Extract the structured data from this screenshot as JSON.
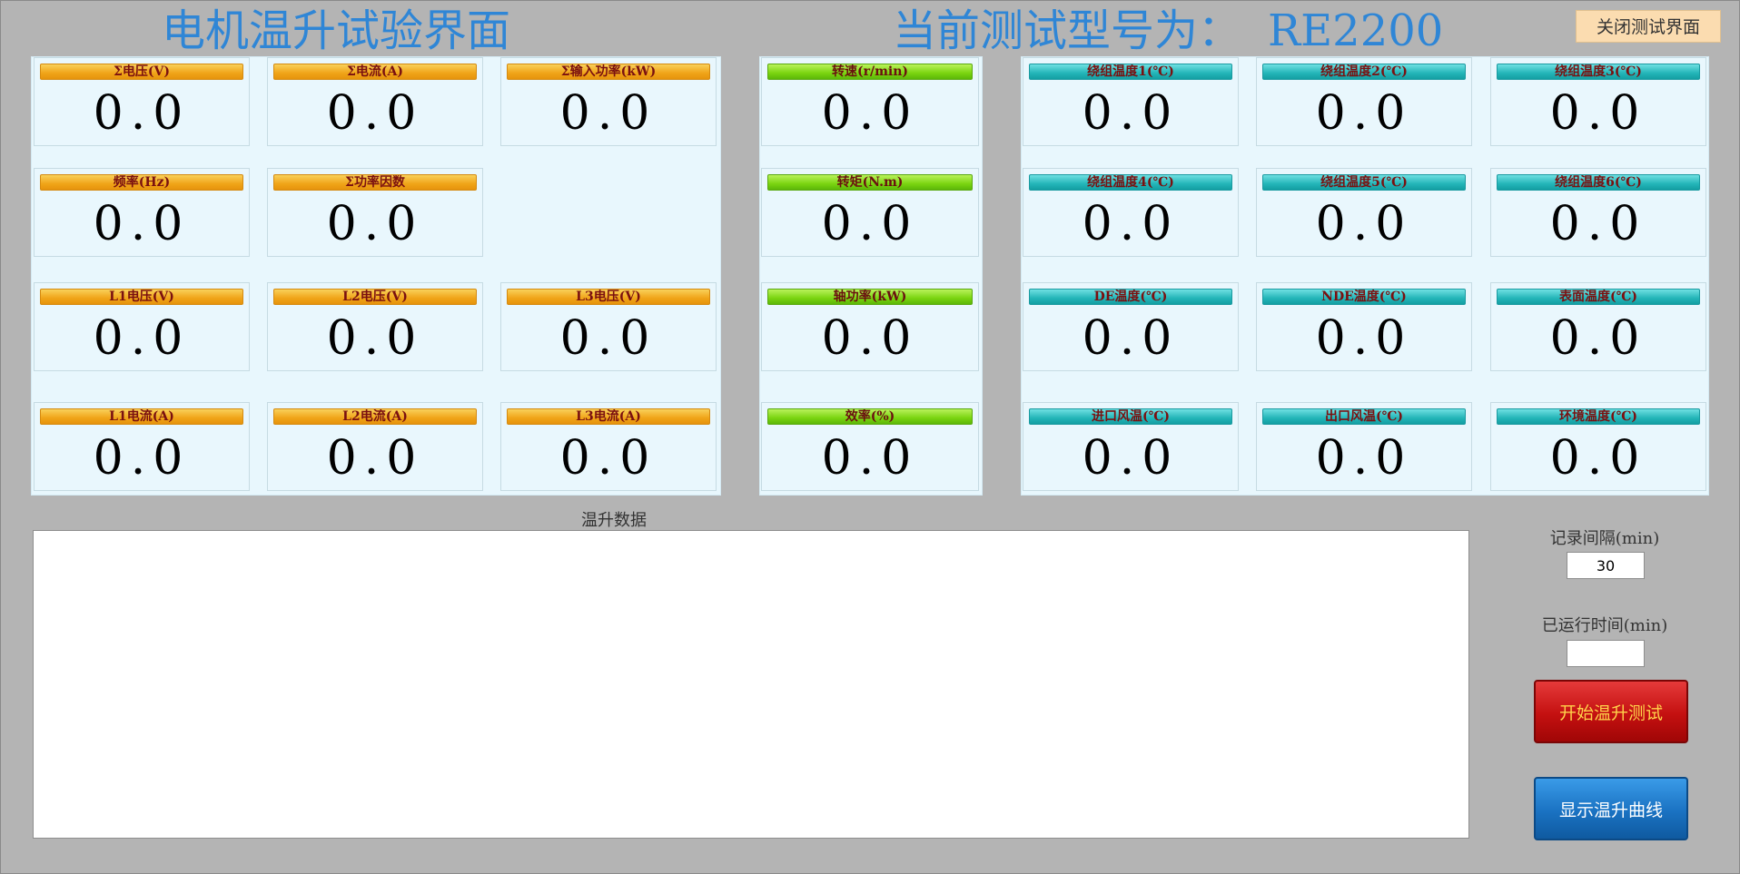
{
  "header": {
    "app_title": "电机温升试验界面",
    "model_title": "当前测试型号为：",
    "model_value": "RE2200",
    "close_button": "关闭测试界面"
  },
  "colors": {
    "title_blue": "#2f86d6",
    "label_orange": "#f0a418",
    "label_green": "#7ad410",
    "label_teal": "#23b5b8",
    "start_red": "#c41010",
    "curve_blue": "#1a72c2"
  },
  "electrical": [
    {
      "label": "Σ电压(V)",
      "value": "0.0"
    },
    {
      "label": "Σ电流(A)",
      "value": "0.0"
    },
    {
      "label": "Σ输入功率(kW)",
      "value": "0.0"
    },
    {
      "label": "频率(Hz)",
      "value": "0.0"
    },
    {
      "label": "Σ功率因数",
      "value": "0.0"
    },
    {
      "label": "L1电压(V)",
      "value": "0.0"
    },
    {
      "label": "L2电压(V)",
      "value": "0.0"
    },
    {
      "label": "L3电压(V)",
      "value": "0.0"
    },
    {
      "label": "L1电流(A)",
      "value": "0.0"
    },
    {
      "label": "L2电流(A)",
      "value": "0.0"
    },
    {
      "label": "L3电流(A)",
      "value": "0.0"
    }
  ],
  "mechanical": [
    {
      "label": "转速(r/min)",
      "value": "0.0"
    },
    {
      "label": "转矩(N.m)",
      "value": "0.0"
    },
    {
      "label": "轴功率(kW)",
      "value": "0.0"
    },
    {
      "label": "效率(%)",
      "value": "0.0"
    }
  ],
  "temperature": [
    {
      "label": "绕组温度1(℃)",
      "value": "0.0"
    },
    {
      "label": "绕组温度2(℃)",
      "value": "0.0"
    },
    {
      "label": "绕组温度3(℃)",
      "value": "0.0"
    },
    {
      "label": "绕组温度4(℃)",
      "value": "0.0"
    },
    {
      "label": "绕组温度5(℃)",
      "value": "0.0"
    },
    {
      "label": "绕组温度6(℃)",
      "value": "0.0"
    },
    {
      "label": "DE温度(℃)",
      "value": "0.0"
    },
    {
      "label": "NDE温度(℃)",
      "value": "0.0"
    },
    {
      "label": "表面温度(℃)",
      "value": "0.0"
    },
    {
      "label": "进口风温(℃)",
      "value": "0.0"
    },
    {
      "label": "出口风温(℃)",
      "value": "0.0"
    },
    {
      "label": "环境温度(℃)",
      "value": "0.0"
    }
  ],
  "data_section": {
    "caption": "温升数据"
  },
  "controls": {
    "interval_label": "记录间隔(min)",
    "interval_value": "30",
    "elapsed_label": "已运行时间(min)",
    "elapsed_value": "",
    "start_button": "开始温升测试",
    "curve_button": "显示温升曲线"
  }
}
